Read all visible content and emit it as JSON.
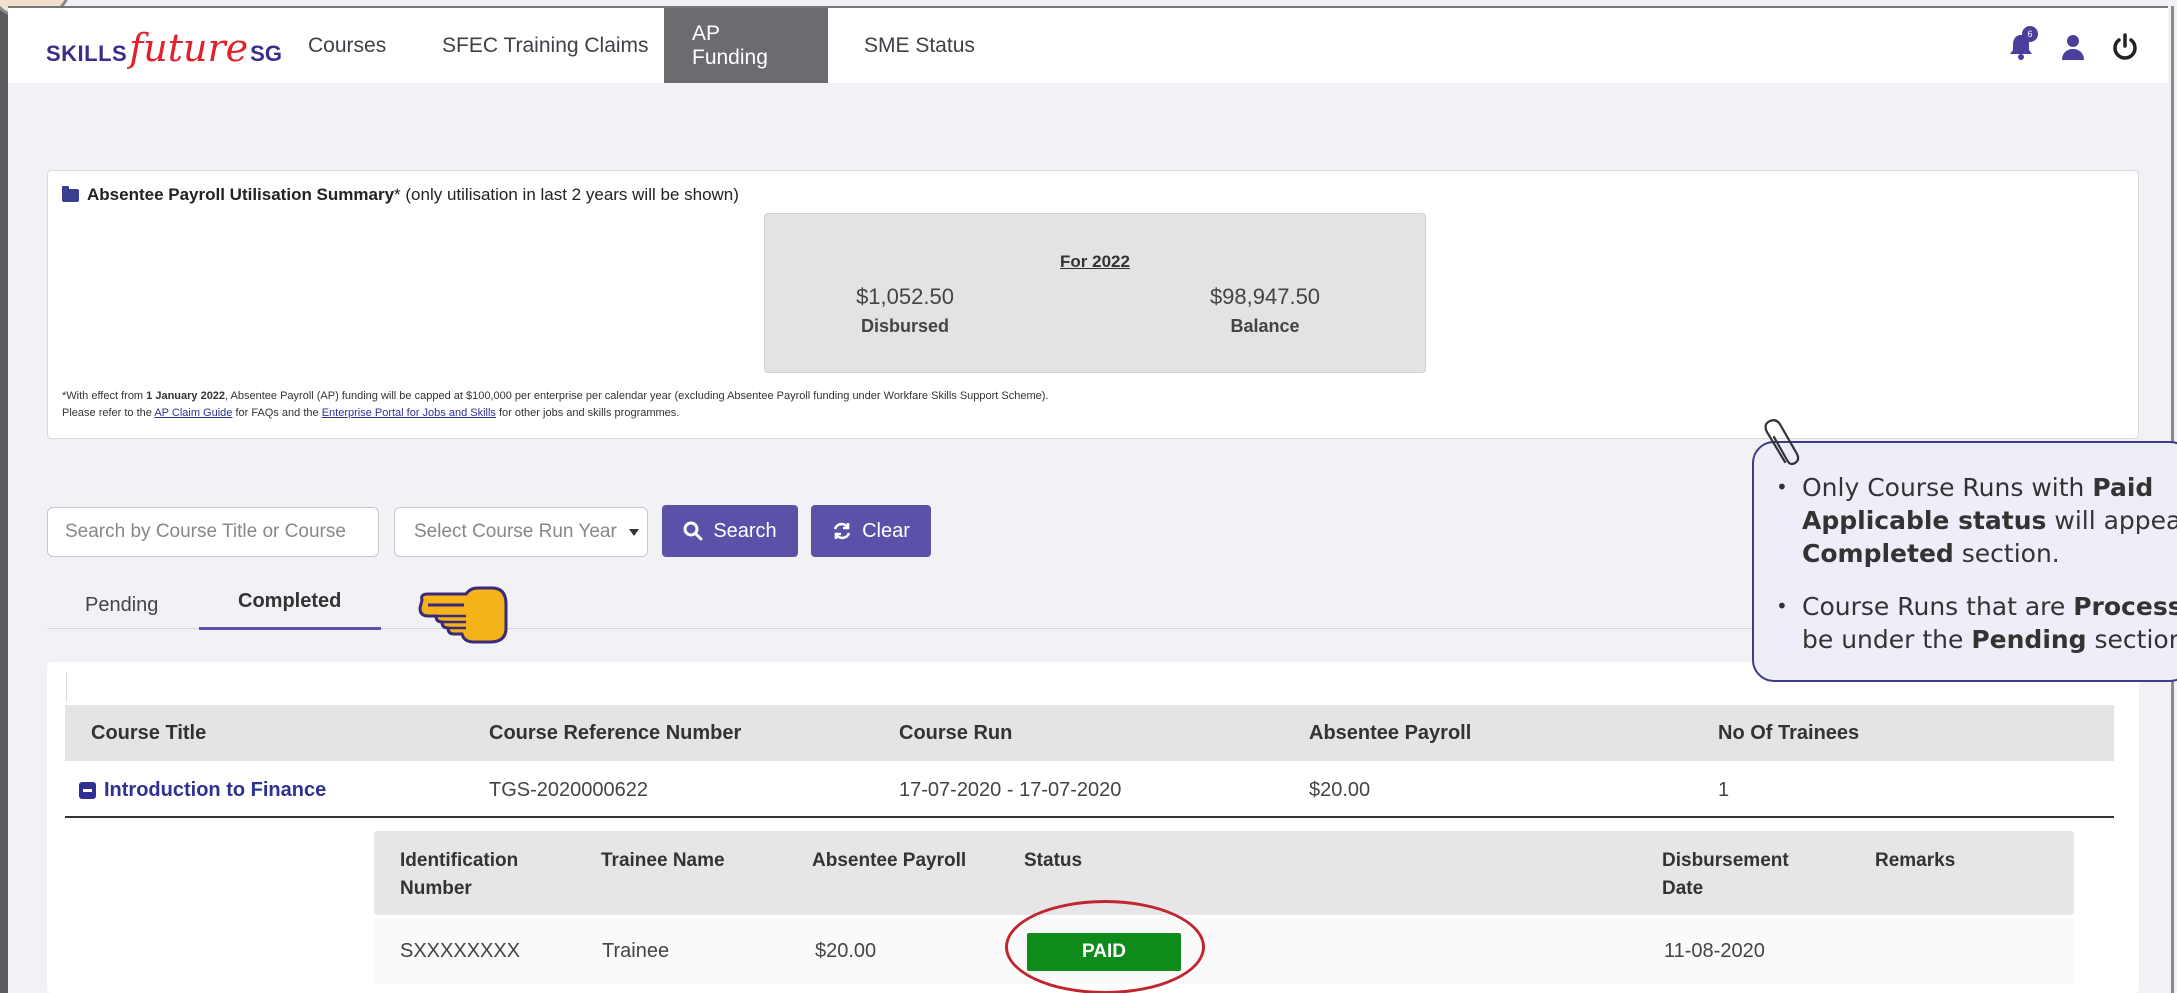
{
  "nav": {
    "logo_part1": "SKILLS",
    "logo_part2": "future",
    "logo_part3": "SG",
    "items": [
      "Courses",
      "SFEC Training Claims",
      "AP Funding",
      "SME Status"
    ],
    "active_index": 2,
    "notification_count": "6",
    "icons": [
      "bell-icon",
      "user-icon",
      "power-icon"
    ]
  },
  "summary": {
    "title_bold": "Absentee Payroll Utilisation Summary",
    "title_rest": "* (only utilisation in last 2 years will be shown)",
    "year_label": "For 2022",
    "disbursed_value": "$1,052.50",
    "disbursed_label": "Disbursed",
    "balance_value": "$98,947.50",
    "balance_label": "Balance",
    "note1_a": "*With effect from ",
    "note1_b": "1 January 2022",
    "note1_c": ", Absentee Payroll (AP) funding will be capped at $100,000 per enterprise per calendar year (excluding Absentee Payroll funding under Workfare Skills Support Scheme).",
    "note2_a": "Please refer to the ",
    "note2_link1": "AP Claim Guide",
    "note2_b": " for FAQs and the ",
    "note2_link2": "Enterprise Portal for Jobs and Skills",
    "note2_c": " for other jobs and skills programmes."
  },
  "search": {
    "placeholder": "Search by Course Title or Course",
    "year_placeholder": "Select Course Run Year",
    "search_label": "Search",
    "clear_label": "Clear"
  },
  "tabs": [
    "Pending",
    "Completed"
  ],
  "table": {
    "headers": [
      "Course Title",
      "Course Reference Number",
      "Course Run",
      "Absentee Payroll",
      "No Of Trainees"
    ],
    "row": {
      "title": "Introduction to Finance",
      "ref": "TGS-2020000622",
      "run": "17-07-2020 - 17-07-2020",
      "payroll": "$20.00",
      "trainees": "1"
    },
    "sub_headers": {
      "id_1": "Identification",
      "id_2": "Number",
      "name": "Trainee Name",
      "payroll": "Absentee Payroll",
      "status": "Status",
      "date_1": "Disbursement",
      "date_2": "Date",
      "remarks": "Remarks"
    },
    "sub_row": {
      "id": "SXXXXXXXX",
      "name": "Trainee",
      "payroll": "$20.00",
      "status": "PAID",
      "date": "11-08-2020",
      "remarks": ""
    }
  },
  "callout": {
    "b1_a": "Only Course Runs with ",
    "b1_b": "Paid",
    "b1_c": "Applicable status",
    "b1_d": " will appea",
    "b1_e": "Completed",
    "b1_f": " section.",
    "b2_a": "Course Runs that are ",
    "b2_b": "Process",
    "b2_c": "be under the ",
    "b2_d": "Pending",
    "b2_e": " section"
  },
  "colors": {
    "brand_purple": "#5b51a8",
    "paid_green": "#0f8b1c",
    "highlight_red": "#c0262d"
  }
}
